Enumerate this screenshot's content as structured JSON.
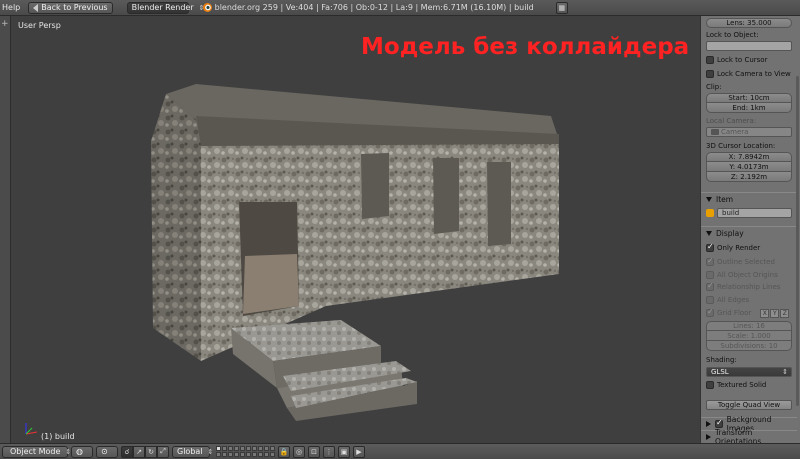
{
  "header": {
    "help_menu": "Help",
    "back_button": "Back to Previous",
    "render_engine": "Blender Render",
    "stats": "blender.org 259 | Ve:404 | Fa:706 | Ob:0-12 | La:9 | Mem:6.71M (16.10M) | build"
  },
  "viewport": {
    "view_label": "User Persp",
    "overlay_title": "Модель без коллайдера",
    "object_label": "(1) build",
    "title_color": "#ff2222"
  },
  "panel": {
    "lens": "Lens: 35.000",
    "lock_to_object_label": "Lock to Object:",
    "lock_to_cursor": "Lock to Cursor",
    "lock_camera_to_view": "Lock Camera to View",
    "clip_label": "Clip:",
    "clip_start": "Start: 10cm",
    "clip_end": "End: 1km",
    "local_camera_label": "Local Camera:",
    "local_camera_value": "Camera",
    "cursor_label": "3D Cursor Location:",
    "cursor_x": "X: 7.8942m",
    "cursor_y": "Y: 4.0173m",
    "cursor_z": "Z: 2.192m",
    "item_section": "Item",
    "item_name": "build",
    "display_section": "Display",
    "only_render": "Only Render",
    "outline_selected": "Outline Selected",
    "all_object_origins": "All Object Origins",
    "relationship_lines": "Relationship Lines",
    "all_edges": "All Edges",
    "grid_floor": "Grid Floor",
    "axis_x": "X",
    "axis_y": "Y",
    "axis_z": "Z",
    "lines": "Lines: 16",
    "scale": "Scale: 1.000",
    "subdivisions": "Subdivisions: 10",
    "shading_label": "Shading:",
    "shading_value": "GLSL",
    "textured_solid": "Textured Solid",
    "toggle_quad_view": "Toggle Quad View",
    "background_images": "Background Images",
    "transform_orientations": "Transform Orientations"
  },
  "footer": {
    "mode": "Object Mode",
    "orientation": "Global"
  }
}
